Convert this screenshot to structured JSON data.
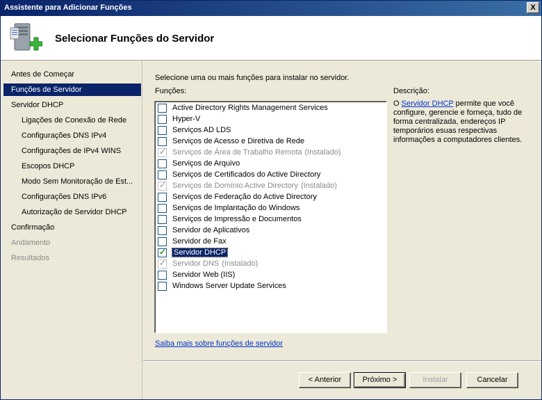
{
  "window": {
    "title": "Assistente para Adicionar Funções",
    "close_label": "X"
  },
  "header": {
    "title": "Selecionar Funções do Servidor",
    "icon": "server-roles-add-icon"
  },
  "nav": {
    "items": [
      {
        "label": "Antes de Começar",
        "state": "normal"
      },
      {
        "label": "Funções de Servidor",
        "state": "active"
      },
      {
        "label": "Servidor DHCP",
        "state": "normal"
      },
      {
        "label": "Ligações de Conexão de Rede",
        "state": "sub"
      },
      {
        "label": "Configurações DNS IPv4",
        "state": "sub"
      },
      {
        "label": "Configurações de IPv4 WINS",
        "state": "sub"
      },
      {
        "label": "Escopos DHCP",
        "state": "sub"
      },
      {
        "label": "Modo Sem Monitoração de Est...",
        "state": "sub"
      },
      {
        "label": "Configurações DNS IPv6",
        "state": "sub"
      },
      {
        "label": "Autorização de Servidor DHCP",
        "state": "sub"
      },
      {
        "label": "Confirmação",
        "state": "normal"
      },
      {
        "label": "Andamento",
        "state": "disabled"
      },
      {
        "label": "Resultados",
        "state": "disabled"
      }
    ]
  },
  "main": {
    "instruction": "Selecione uma ou mais funções para instalar no servidor.",
    "roles_label": "Funções:",
    "roles": [
      {
        "label": "Active Directory Rights Management Services",
        "state": "unchecked",
        "note": ""
      },
      {
        "label": "Hyper-V",
        "state": "unchecked",
        "note": ""
      },
      {
        "label": "Serviços AD LDS",
        "state": "unchecked",
        "note": ""
      },
      {
        "label": "Serviços de Acesso e Diretiva de Rede",
        "state": "unchecked",
        "note": ""
      },
      {
        "label": "Serviços de Área de Trabalho Remota",
        "state": "installed",
        "note": "(Instalado)"
      },
      {
        "label": "Serviços de Arquivo",
        "state": "unchecked",
        "note": ""
      },
      {
        "label": "Serviços de Certificados do Active Directory",
        "state": "unchecked",
        "note": ""
      },
      {
        "label": "Serviços de Domínio Active Directory",
        "state": "installed",
        "note": "(Instalado)"
      },
      {
        "label": "Serviços de Federação do Active Directory",
        "state": "unchecked",
        "note": ""
      },
      {
        "label": "Serviços de Implantação do Windows",
        "state": "unchecked",
        "note": ""
      },
      {
        "label": "Serviços de Impressão e Documentos",
        "state": "unchecked",
        "note": ""
      },
      {
        "label": "Servidor de Aplicativos",
        "state": "unchecked",
        "note": ""
      },
      {
        "label": "Servidor de Fax",
        "state": "unchecked",
        "note": ""
      },
      {
        "label": "Servidor DHCP",
        "state": "checked-selected",
        "note": ""
      },
      {
        "label": "Servidor DNS",
        "state": "installed",
        "note": "(Instalado)"
      },
      {
        "label": "Servidor Web (IIS)",
        "state": "unchecked",
        "note": ""
      },
      {
        "label": "Windows Server Update Services",
        "state": "unchecked",
        "note": ""
      }
    ],
    "description_label": "Descrição:",
    "description_prefix": "O ",
    "description_link": "Servidor DHCP",
    "description_body": " permite que você configure, gerencie e forneça, tudo de forma centralizada, endereços IP temporários esuas respectivas informações a computadores clientes.",
    "learn_more": "Saiba mais sobre funções de servidor"
  },
  "buttons": {
    "back": "< Anterior",
    "next": "Próximo >",
    "install": "Instalar",
    "cancel": "Cancelar"
  }
}
